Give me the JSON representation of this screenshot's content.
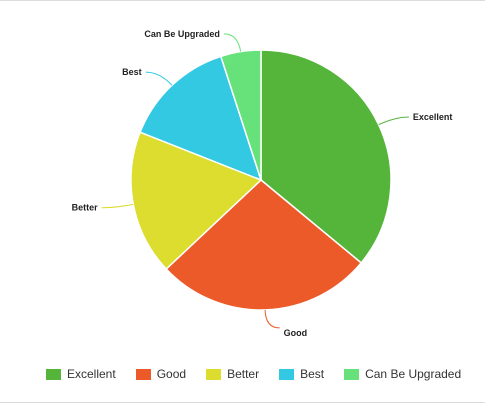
{
  "chart_data": {
    "type": "pie",
    "title": "",
    "categories": [
      "Excellent",
      "Good",
      "Better",
      "Best",
      "Can Be Upgraded"
    ],
    "values": [
      36,
      27,
      18,
      14,
      5
    ],
    "colors": [
      "#55b43a",
      "#ec5a2a",
      "#dcdd2e",
      "#33c9e2",
      "#67e27b"
    ],
    "legend_position": "bottom"
  }
}
